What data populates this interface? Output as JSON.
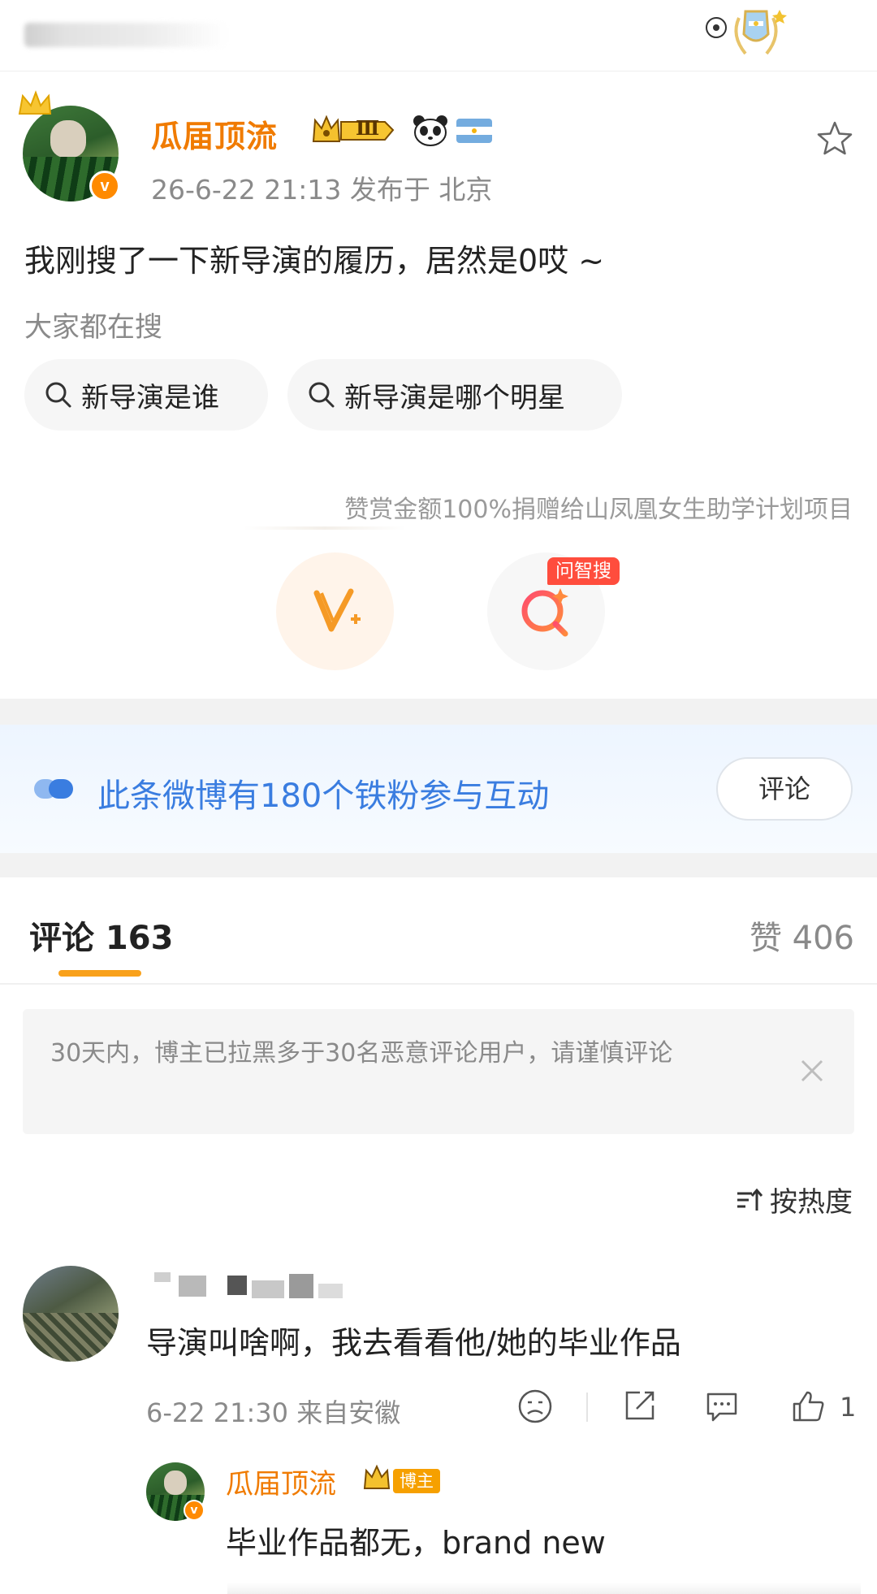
{
  "post": {
    "author": "瓜届顶流",
    "level_badge": "Ⅲ",
    "verified_mark": "v",
    "meta": "26-6-22 21:13  发布于 北京",
    "text": "我刚搜了一下新导演的履历，居然是0哎 ~"
  },
  "search": {
    "label": "大家都在搜",
    "pills": [
      "新导演是谁",
      "新导演是哪个明星"
    ]
  },
  "reward_note": "赞赏金额100%捐赠给山凤凰女生助学计划项目",
  "ask_tag": "问智搜",
  "fans_banner": {
    "text": "此条微博有180个铁粉参与互动",
    "button": "评论"
  },
  "tabs": {
    "comments": "评论 163",
    "likes": "赞 406"
  },
  "notice": "30天内，博主已拉黑多于30名恶意评论用户，请谨慎评论",
  "sort_label": "按热度",
  "comment": {
    "text": "导演叫啥啊，我去看看他/她的毕业作品",
    "meta": "6-22 21:30  来自安徽",
    "likes": "1"
  },
  "reply": {
    "author": "瓜届顶流",
    "tag": "博主",
    "text": "毕业作品都无，brand new"
  },
  "colors": {
    "accent_orange": "#f07b00",
    "link_blue": "#3a7de0",
    "underline": "#f9a11b"
  },
  "icons": [
    "star-icon",
    "search-icon",
    "v-plus-icon",
    "ai-search-icon",
    "close-icon",
    "sort-icon",
    "dislike-icon",
    "share-icon",
    "comment-icon",
    "like-icon"
  ]
}
